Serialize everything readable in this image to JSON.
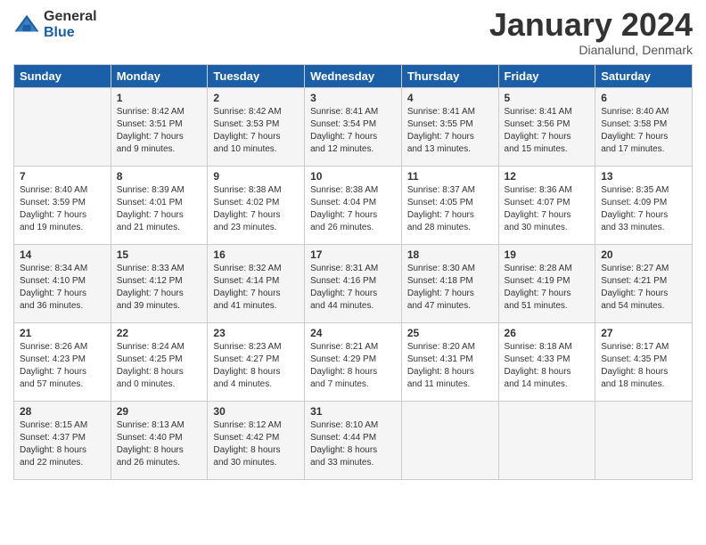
{
  "header": {
    "logo_general": "General",
    "logo_blue": "Blue",
    "month_title": "January 2024",
    "location": "Dianalund, Denmark"
  },
  "days_of_week": [
    "Sunday",
    "Monday",
    "Tuesday",
    "Wednesday",
    "Thursday",
    "Friday",
    "Saturday"
  ],
  "weeks": [
    [
      {
        "num": "",
        "info": ""
      },
      {
        "num": "1",
        "info": "Sunrise: 8:42 AM\nSunset: 3:51 PM\nDaylight: 7 hours\nand 9 minutes."
      },
      {
        "num": "2",
        "info": "Sunrise: 8:42 AM\nSunset: 3:53 PM\nDaylight: 7 hours\nand 10 minutes."
      },
      {
        "num": "3",
        "info": "Sunrise: 8:41 AM\nSunset: 3:54 PM\nDaylight: 7 hours\nand 12 minutes."
      },
      {
        "num": "4",
        "info": "Sunrise: 8:41 AM\nSunset: 3:55 PM\nDaylight: 7 hours\nand 13 minutes."
      },
      {
        "num": "5",
        "info": "Sunrise: 8:41 AM\nSunset: 3:56 PM\nDaylight: 7 hours\nand 15 minutes."
      },
      {
        "num": "6",
        "info": "Sunrise: 8:40 AM\nSunset: 3:58 PM\nDaylight: 7 hours\nand 17 minutes."
      }
    ],
    [
      {
        "num": "7",
        "info": "Sunrise: 8:40 AM\nSunset: 3:59 PM\nDaylight: 7 hours\nand 19 minutes."
      },
      {
        "num": "8",
        "info": "Sunrise: 8:39 AM\nSunset: 4:01 PM\nDaylight: 7 hours\nand 21 minutes."
      },
      {
        "num": "9",
        "info": "Sunrise: 8:38 AM\nSunset: 4:02 PM\nDaylight: 7 hours\nand 23 minutes."
      },
      {
        "num": "10",
        "info": "Sunrise: 8:38 AM\nSunset: 4:04 PM\nDaylight: 7 hours\nand 26 minutes."
      },
      {
        "num": "11",
        "info": "Sunrise: 8:37 AM\nSunset: 4:05 PM\nDaylight: 7 hours\nand 28 minutes."
      },
      {
        "num": "12",
        "info": "Sunrise: 8:36 AM\nSunset: 4:07 PM\nDaylight: 7 hours\nand 30 minutes."
      },
      {
        "num": "13",
        "info": "Sunrise: 8:35 AM\nSunset: 4:09 PM\nDaylight: 7 hours\nand 33 minutes."
      }
    ],
    [
      {
        "num": "14",
        "info": "Sunrise: 8:34 AM\nSunset: 4:10 PM\nDaylight: 7 hours\nand 36 minutes."
      },
      {
        "num": "15",
        "info": "Sunrise: 8:33 AM\nSunset: 4:12 PM\nDaylight: 7 hours\nand 39 minutes."
      },
      {
        "num": "16",
        "info": "Sunrise: 8:32 AM\nSunset: 4:14 PM\nDaylight: 7 hours\nand 41 minutes."
      },
      {
        "num": "17",
        "info": "Sunrise: 8:31 AM\nSunset: 4:16 PM\nDaylight: 7 hours\nand 44 minutes."
      },
      {
        "num": "18",
        "info": "Sunrise: 8:30 AM\nSunset: 4:18 PM\nDaylight: 7 hours\nand 47 minutes."
      },
      {
        "num": "19",
        "info": "Sunrise: 8:28 AM\nSunset: 4:19 PM\nDaylight: 7 hours\nand 51 minutes."
      },
      {
        "num": "20",
        "info": "Sunrise: 8:27 AM\nSunset: 4:21 PM\nDaylight: 7 hours\nand 54 minutes."
      }
    ],
    [
      {
        "num": "21",
        "info": "Sunrise: 8:26 AM\nSunset: 4:23 PM\nDaylight: 7 hours\nand 57 minutes."
      },
      {
        "num": "22",
        "info": "Sunrise: 8:24 AM\nSunset: 4:25 PM\nDaylight: 8 hours\nand 0 minutes."
      },
      {
        "num": "23",
        "info": "Sunrise: 8:23 AM\nSunset: 4:27 PM\nDaylight: 8 hours\nand 4 minutes."
      },
      {
        "num": "24",
        "info": "Sunrise: 8:21 AM\nSunset: 4:29 PM\nDaylight: 8 hours\nand 7 minutes."
      },
      {
        "num": "25",
        "info": "Sunrise: 8:20 AM\nSunset: 4:31 PM\nDaylight: 8 hours\nand 11 minutes."
      },
      {
        "num": "26",
        "info": "Sunrise: 8:18 AM\nSunset: 4:33 PM\nDaylight: 8 hours\nand 14 minutes."
      },
      {
        "num": "27",
        "info": "Sunrise: 8:17 AM\nSunset: 4:35 PM\nDaylight: 8 hours\nand 18 minutes."
      }
    ],
    [
      {
        "num": "28",
        "info": "Sunrise: 8:15 AM\nSunset: 4:37 PM\nDaylight: 8 hours\nand 22 minutes."
      },
      {
        "num": "29",
        "info": "Sunrise: 8:13 AM\nSunset: 4:40 PM\nDaylight: 8 hours\nand 26 minutes."
      },
      {
        "num": "30",
        "info": "Sunrise: 8:12 AM\nSunset: 4:42 PM\nDaylight: 8 hours\nand 30 minutes."
      },
      {
        "num": "31",
        "info": "Sunrise: 8:10 AM\nSunset: 4:44 PM\nDaylight: 8 hours\nand 33 minutes."
      },
      {
        "num": "",
        "info": ""
      },
      {
        "num": "",
        "info": ""
      },
      {
        "num": "",
        "info": ""
      }
    ]
  ]
}
